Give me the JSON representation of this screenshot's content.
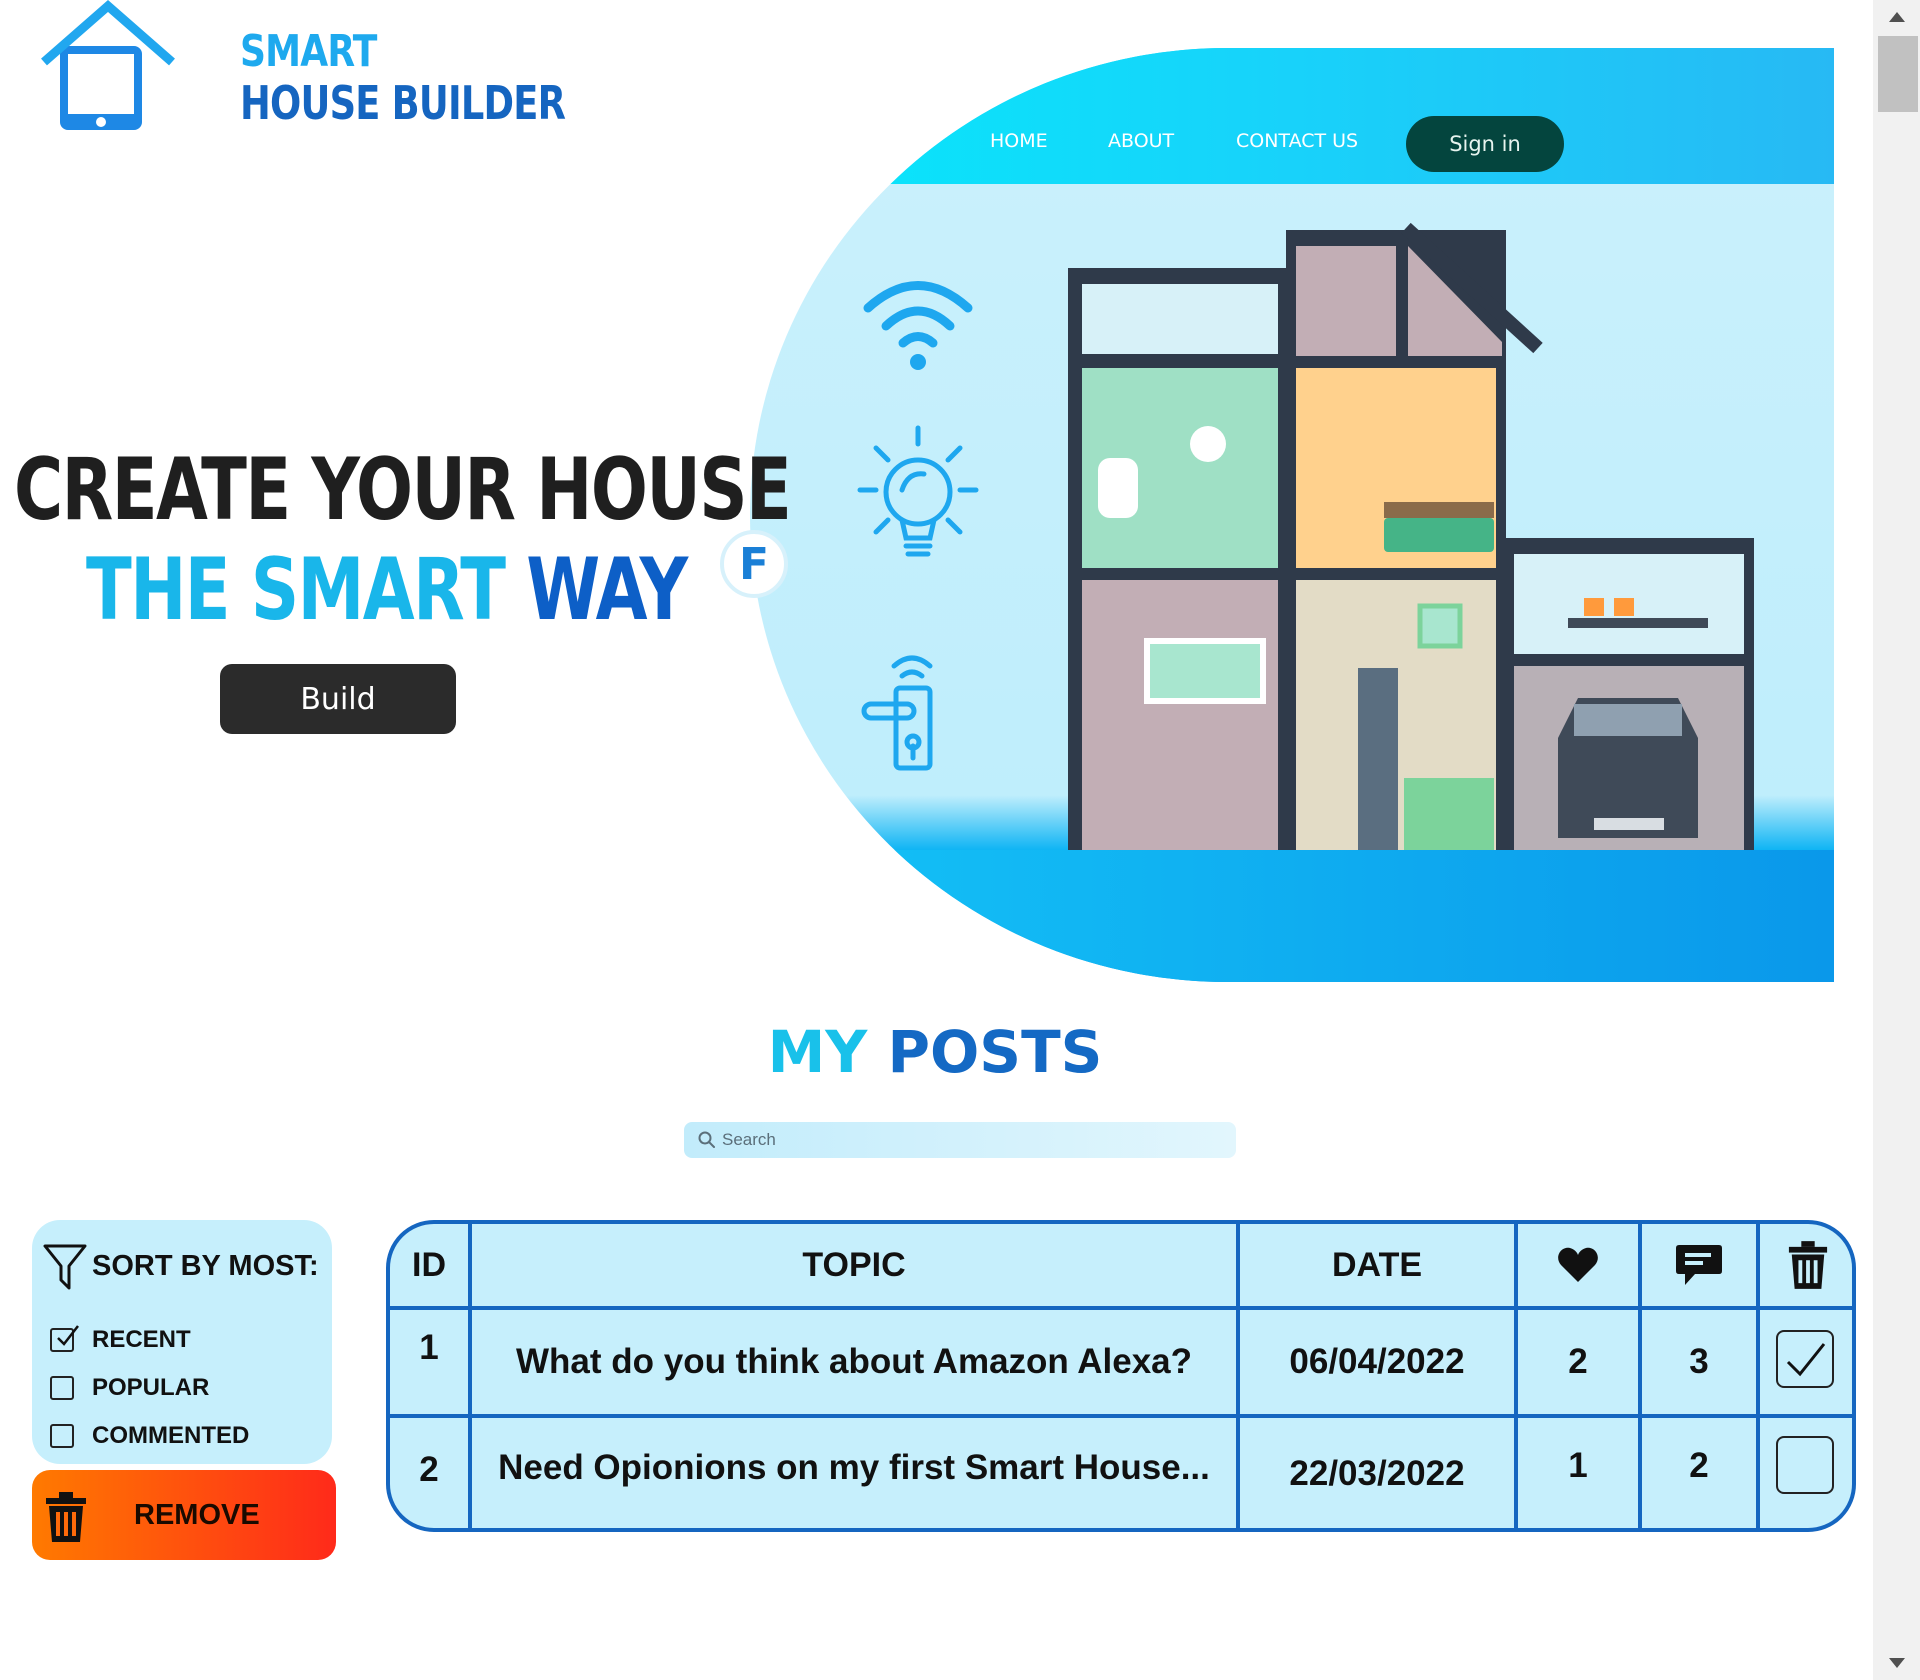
{
  "brand": {
    "line1": "SMART",
    "line2": "HOUSE BUILDER"
  },
  "nav": {
    "items": [
      "HOME",
      "ABOUT",
      "CONTACT US"
    ],
    "signin_label": "Sign in"
  },
  "hero": {
    "headline_line1": "CREATE YOUR HOUSE",
    "headline_line2_part1": "THE SMART",
    "headline_line2_part2": "WAY",
    "build_label": "Build",
    "badge_letter": "F",
    "feature_icons": [
      "wifi-icon",
      "lightbulb-icon",
      "smart-lock-icon"
    ]
  },
  "posts": {
    "title_part1": "MY",
    "title_part2": "POSTS",
    "search_placeholder": "Search",
    "sort": {
      "label": "SORT BY MOST:",
      "options": [
        {
          "label": "RECENT",
          "checked": true
        },
        {
          "label": "POPULAR",
          "checked": false
        },
        {
          "label": "COMMENTED",
          "checked": false
        }
      ]
    },
    "remove_label": "REMOVE",
    "table": {
      "headers": {
        "id": "ID",
        "topic": "TOPIC",
        "date": "DATE",
        "likes_icon": "heart-icon",
        "comments_icon": "comment-icon",
        "delete_icon": "trash-icon"
      },
      "rows": [
        {
          "id": "1",
          "topic": "What do you think about Amazon Alexa?",
          "date": "06/04/2022",
          "likes": "2",
          "comments": "3",
          "selected": true
        },
        {
          "id": "2",
          "topic": "Need Opionions on my first Smart House...",
          "date": "22/03/2022",
          "likes": "1",
          "comments": "2",
          "selected": false
        }
      ]
    }
  },
  "colors": {
    "primary_blue": "#1566c0",
    "cyan": "#19b6ea",
    "panel_bg": "#c6effc",
    "remove_start": "#ff7a00",
    "remove_end": "#ff2a1a",
    "signin_bg": "#04453e"
  }
}
